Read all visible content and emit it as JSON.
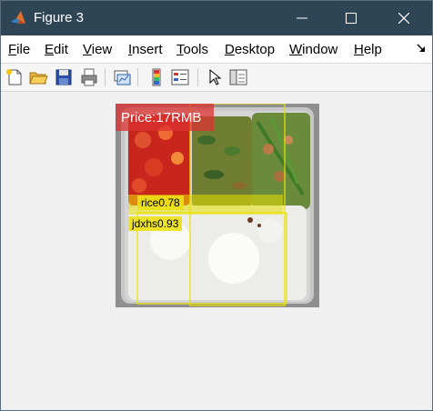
{
  "window": {
    "title": "Figure 3"
  },
  "menubar": {
    "items": [
      {
        "label": "File",
        "underline": "F",
        "rest": "ile"
      },
      {
        "label": "Edit",
        "underline": "E",
        "rest": "dit"
      },
      {
        "label": "View",
        "underline": "V",
        "rest": "iew"
      },
      {
        "label": "Insert",
        "underline": "I",
        "rest": "nsert"
      },
      {
        "label": "Tools",
        "underline": "T",
        "rest": "ools"
      },
      {
        "label": "Desktop",
        "underline": "D",
        "rest": "esktop"
      },
      {
        "label": "Window",
        "underline": "W",
        "rest": "indow"
      },
      {
        "label": "Help",
        "underline": "H",
        "rest": "elp"
      }
    ]
  },
  "toolbar": {
    "buttons": [
      "new-figure-icon",
      "open-file-icon",
      "save-icon",
      "print-icon",
      "link-plot-icon",
      "colorbar-icon",
      "legend-icon",
      "pointer-icon",
      "property-inspector-icon"
    ]
  },
  "figure": {
    "price_label": "Price:17RMB",
    "detections": [
      {
        "label": "rice0.78",
        "color": "#e8e000"
      },
      {
        "label": "jdxhs0.93",
        "color": "#e8e000"
      }
    ],
    "price_box_color": "#dc3232"
  },
  "colors": {
    "titlebar": "#2e4556",
    "menubar": "#ffffff",
    "figure_bg": "#f0f0f0"
  }
}
